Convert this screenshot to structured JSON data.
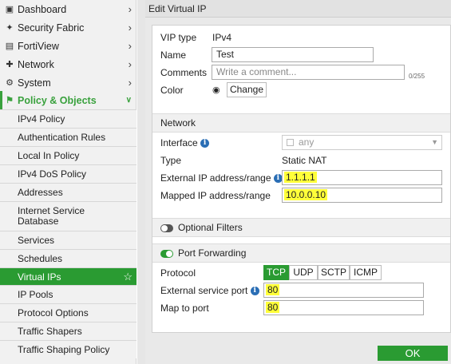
{
  "colors": {
    "accent": "#2a9b32",
    "highlight": "#ffff3a",
    "info": "#2a6eb5"
  },
  "sidebar": {
    "top_items": [
      {
        "label": "Dashboard",
        "icon": "dashboard-icon"
      },
      {
        "label": "Security Fabric",
        "icon": "security-fabric-icon"
      },
      {
        "label": "FortiView",
        "icon": "fortiview-icon"
      },
      {
        "label": "Network",
        "icon": "network-icon"
      },
      {
        "label": "System",
        "icon": "system-icon"
      },
      {
        "label": "Policy & Objects",
        "icon": "policy-objects-icon"
      }
    ],
    "sub_items": [
      "IPv4 Policy",
      "Authentication Rules",
      "Local In Policy",
      "IPv4 DoS Policy",
      "Addresses",
      "Internet Service Database",
      "Services",
      "Schedules",
      "Virtual IPs",
      "IP Pools",
      "Protocol Options",
      "Traffic Shapers",
      "Traffic Shaping Policy"
    ],
    "sub_wrap": {
      "line1": "Internet Service",
      "line2": "Database"
    }
  },
  "dialog": {
    "title": "Edit Virtual IP",
    "vip_type_label": "VIP type",
    "vip_type_value": "IPv4",
    "name_label": "Name",
    "name_value": "Test",
    "comments_label": "Comments",
    "comments_placeholder": "Write a comment...",
    "comments_count": "0/255",
    "color_label": "Color",
    "color_change": "Change",
    "network_section": "Network",
    "interface_label": "Interface",
    "interface_value": "any",
    "type_label": "Type",
    "type_value": "Static NAT",
    "external_ip_label": "External IP address/range",
    "external_ip_value": "1.1.1.1",
    "mapped_ip_label": "Mapped IP address/range",
    "mapped_ip_value": "10.0.0.10",
    "optional_filters": "Optional Filters",
    "optional_filters_enabled": false,
    "port_forwarding": "Port Forwarding",
    "port_forwarding_enabled": true,
    "protocol_label": "Protocol",
    "protocols": [
      "TCP",
      "UDP",
      "SCTP",
      "ICMP"
    ],
    "protocol_selected": "TCP",
    "external_port_label": "External service port",
    "external_port_value": "80",
    "map_port_label": "Map to port",
    "map_port_value": "80",
    "ok": "OK"
  }
}
